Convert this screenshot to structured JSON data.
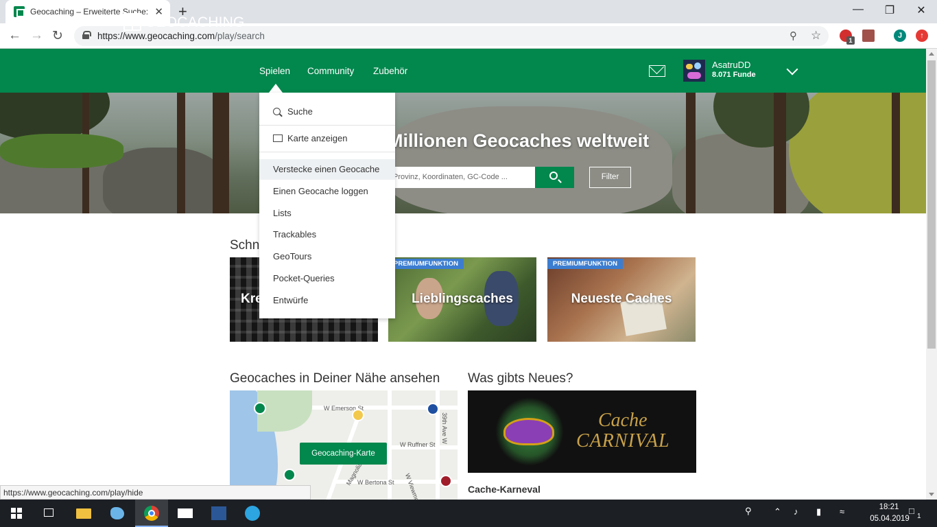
{
  "browser": {
    "tab_title": "Geocaching – Erweiterte Suche: F",
    "tab_close": "✕",
    "new_tab": "+",
    "url_domain": "https://www.geocaching.com",
    "url_path": "/play/search",
    "status_url": "https://www.geocaching.com/play/hide",
    "profile_initial": "J",
    "ext_badge": "1"
  },
  "header": {
    "logo_text": "GEOCACHING",
    "nav": [
      "Spielen",
      "Community",
      "Zubehör"
    ],
    "username": "AsatruDD",
    "finds": "8.071 Funde"
  },
  "hero": {
    "title": "Millionen Geocaches weltweit",
    "search_placeholder": "Provinz, Koordinaten, GC-Code ...",
    "filter_label": "Filter"
  },
  "dropdown": {
    "items": [
      {
        "label": "Suche",
        "icon": "search-icon"
      },
      {
        "label": "Karte anzeigen",
        "icon": "map-icon"
      },
      {
        "label": "Verstecke einen Geocache"
      },
      {
        "label": "Einen Geocache loggen"
      },
      {
        "label": "Lists"
      },
      {
        "label": "Trackables"
      },
      {
        "label": "GeoTours"
      },
      {
        "label": "Pocket-Queries"
      },
      {
        "label": "Entwürfe"
      }
    ]
  },
  "quick": {
    "title": "Schnellsuche",
    "cards": [
      {
        "label": "Kreise",
        "badge": ""
      },
      {
        "label": "Lieblingscaches",
        "badge": "PREMIUMFUNKTION"
      },
      {
        "label": "Neueste Caches",
        "badge": "PREMIUMFUNKTION"
      }
    ]
  },
  "nearby": {
    "title": "Geocaches in Deiner Nähe ansehen",
    "map_button": "Geocaching-Karte",
    "streets": [
      "W Emerson St",
      "W Ruffner St",
      "Magnolia Blvd",
      "W Bertona St",
      "39th Ave W",
      "W Viewmont"
    ]
  },
  "news": {
    "title": "Was gibts Neues?",
    "image_line1": "Cache",
    "image_line2": "CARNIVAL",
    "caption": "Cache-Karneval"
  },
  "taskbar": {
    "time": "18:21",
    "date": "05.04.2019",
    "notif_count": "1"
  },
  "colors": {
    "brand_green": "#02874d",
    "premium_blue": "#3c7dd0"
  }
}
